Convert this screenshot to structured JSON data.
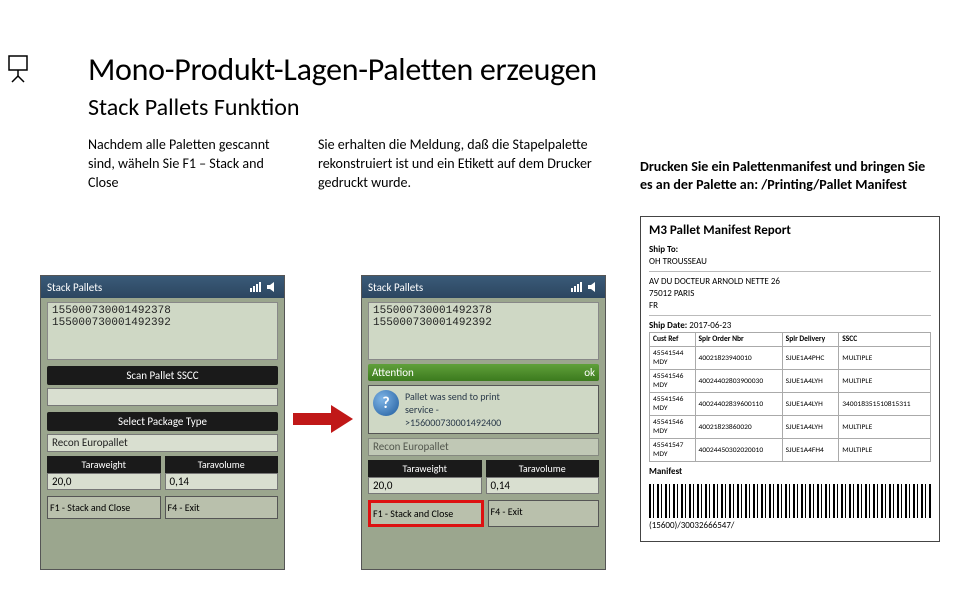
{
  "title": "Mono-Produkt-Lagen-Paletten erzeugen",
  "subtitle": "Stack Pallets Funktion",
  "leftText": "Nachdem alle Paletten gescannt sind, wäheln Sie F1 – Stack and Close",
  "midText": "Sie erhalten die Meldung, daß die Stapelpalette rekonstruiert ist und ein Etikett auf dem Drucker gedruckt wurde.",
  "rightNote": "Drucken Sie ein Palettenmanifest und bringen Sie es an der Palette an: /Printing/Pallet Manifest",
  "device": {
    "title": "Stack Pallets",
    "sscc1": "155000730001492378",
    "sscc2": "155000730001492392",
    "btnScan": "Scan Pallet SSCC",
    "btnSelectPkg": "Select Package Type",
    "pkgValue": "Recon Europallet",
    "hdrTara": "Taraweight",
    "hdrVol": "Taravolume",
    "valTara": "20,0",
    "valVol": "0,14",
    "f1": "F1 - Stack and Close",
    "f4": "F4 - Exit",
    "attention": "Attention",
    "ok": "ok",
    "msg1": "Pallet was send to print",
    "msg2": "service -",
    "msg3": ">156000730001492400"
  },
  "report": {
    "title": "M3 Pallet Manifest Report",
    "shipTo": "Ship To:",
    "addr1": "OH TROUSSEAU",
    "addr2": "AV DU DOCTEUR ARNOLD NETTE 26",
    "addr3": "75012 PARIS",
    "addr4": "FR",
    "shipDateLbl": "Ship Date:",
    "shipDate": "2017-06-23",
    "cols": [
      "Cust Ref",
      "Splr Order Nbr",
      "Splr Delivery",
      "SSCC"
    ],
    "rows": [
      [
        "45541544\nMDY",
        "40021823940010",
        "SJUE1A4PHC",
        "MULTIPLE"
      ],
      [
        "45541546\nMDY",
        "40024402803900030",
        "SJUE1A4LYH",
        "MULTIPLE"
      ],
      [
        "45541546\nMDY",
        "40024402839600110",
        "SJUE1A4LYH",
        "340018351510815311"
      ],
      [
        "45541546\nMDY",
        "40021823860020",
        "SJUE1A4LYH",
        "MULTIPLE"
      ],
      [
        "45541547\nMDY",
        "40024450302020010",
        "SJUE1A4FH4",
        "MULTIPLE"
      ]
    ],
    "manifestLbl": "Manifest",
    "barcodeText": "(15600)/30032666547/"
  }
}
